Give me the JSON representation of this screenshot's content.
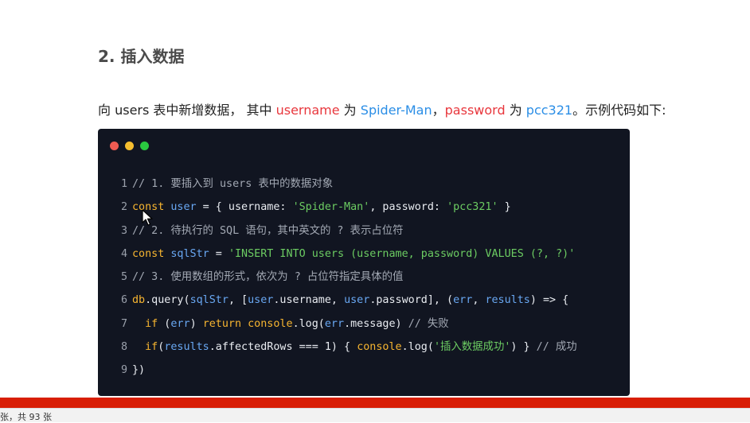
{
  "heading": "2. 插入数据",
  "description": {
    "p1": "向 users 表中新增数据， 其中 ",
    "k1": "username",
    "p2": " 为 ",
    "v1": "Spider-Man",
    "p3": "，",
    "k2": "password",
    "p4": " 为 ",
    "v2": "pcc321",
    "p5": "。示例代码如下:"
  },
  "code_window": {
    "dot_colors": [
      "#ef5b52",
      "#f6be2f",
      "#2ac840"
    ],
    "lines": [
      [
        {
          "t": "ln",
          "v": "1 "
        },
        {
          "t": "cm",
          "v": "// 1. 要插入到 users 表中的数据对象"
        }
      ],
      [
        {
          "t": "ln",
          "v": "2 "
        },
        {
          "t": "kw",
          "v": "const"
        },
        {
          "t": "tx",
          "v": " "
        },
        {
          "t": "va",
          "v": "user"
        },
        {
          "t": "tx",
          "v": " = { username: "
        },
        {
          "t": "st",
          "v": "'Spider-Man'"
        },
        {
          "t": "tx",
          "v": ", password: "
        },
        {
          "t": "st",
          "v": "'pcc321'"
        },
        {
          "t": "tx",
          "v": " }"
        }
      ],
      [
        {
          "t": "ln",
          "v": "3 "
        },
        {
          "t": "cm",
          "v": "// 2. 待执行的 SQL 语句，其中英文的 ? 表示占位符"
        }
      ],
      [
        {
          "t": "ln",
          "v": "4 "
        },
        {
          "t": "kw",
          "v": "const"
        },
        {
          "t": "tx",
          "v": " "
        },
        {
          "t": "va",
          "v": "sqlStr"
        },
        {
          "t": "tx",
          "v": " = "
        },
        {
          "t": "st",
          "v": "'INSERT INTO users (username, password) VALUES (?, ?)'"
        }
      ],
      [
        {
          "t": "ln",
          "v": "5 "
        },
        {
          "t": "cm",
          "v": "// 3. 使用数组的形式，依次为 ? 占位符指定具体的值"
        }
      ],
      [
        {
          "t": "ln",
          "v": "6 "
        },
        {
          "t": "kw",
          "v": "db"
        },
        {
          "t": "tx",
          "v": ".query("
        },
        {
          "t": "va",
          "v": "sqlStr"
        },
        {
          "t": "tx",
          "v": ", ["
        },
        {
          "t": "va",
          "v": "user"
        },
        {
          "t": "tx",
          "v": ".username, "
        },
        {
          "t": "va",
          "v": "user"
        },
        {
          "t": "tx",
          "v": ".password], ("
        },
        {
          "t": "va",
          "v": "err"
        },
        {
          "t": "tx",
          "v": ", "
        },
        {
          "t": "va",
          "v": "results"
        },
        {
          "t": "tx",
          "v": ") => {"
        }
      ],
      [
        {
          "t": "ln",
          "v": "7 "
        },
        {
          "t": "tx",
          "v": "  "
        },
        {
          "t": "kw",
          "v": "if"
        },
        {
          "t": "tx",
          "v": " ("
        },
        {
          "t": "va",
          "v": "err"
        },
        {
          "t": "tx",
          "v": ") "
        },
        {
          "t": "kw",
          "v": "return"
        },
        {
          "t": "tx",
          "v": " "
        },
        {
          "t": "kw",
          "v": "console"
        },
        {
          "t": "tx",
          "v": ".log("
        },
        {
          "t": "va",
          "v": "err"
        },
        {
          "t": "tx",
          "v": ".message) "
        },
        {
          "t": "cm",
          "v": "// 失败"
        }
      ],
      [
        {
          "t": "ln",
          "v": "8 "
        },
        {
          "t": "tx",
          "v": "  "
        },
        {
          "t": "kw",
          "v": "if"
        },
        {
          "t": "tx",
          "v": "("
        },
        {
          "t": "va",
          "v": "results"
        },
        {
          "t": "tx",
          "v": ".affectedRows === 1) { "
        },
        {
          "t": "kw",
          "v": "console"
        },
        {
          "t": "tx",
          "v": ".log("
        },
        {
          "t": "st",
          "v": "'插入数据成功'"
        },
        {
          "t": "tx",
          "v": ") } "
        },
        {
          "t": "cm",
          "v": "// 成功"
        }
      ],
      [
        {
          "t": "ln",
          "v": "9 "
        },
        {
          "t": "tx",
          "v": "})"
        }
      ]
    ]
  },
  "status_bar": {
    "text": "张，共 93 张"
  },
  "colors": {
    "code_background": "#111521",
    "slide_bar": "#d81e06",
    "keyword": "#f7b530",
    "variable": "#69a8f3",
    "string": "#6ccc62",
    "comment": "#a3a9b4"
  },
  "icons": {
    "cursor": "arrow-cursor-icon"
  }
}
